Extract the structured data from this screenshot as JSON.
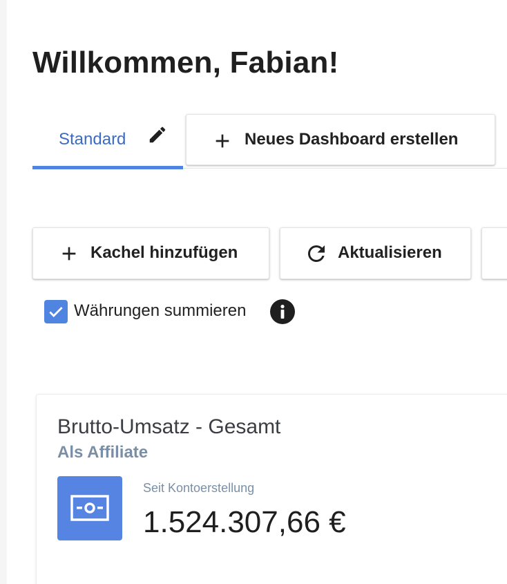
{
  "header": {
    "title": "Willkommen, Fabian!"
  },
  "tabs": {
    "active_tab_label": "Standard",
    "new_dashboard_label": "Neues Dashboard erstellen"
  },
  "toolbar": {
    "add_tile_label": "Kachel hinzufügen",
    "refresh_label": "Aktualisieren"
  },
  "options": {
    "sum_currencies_label": "Währungen summieren",
    "sum_currencies_checked": true
  },
  "card": {
    "title": "Brutto-Umsatz - Gesamt",
    "subtitle": "Als Affiliate",
    "period": "Seit Kontoerstellung",
    "value": "1.524.307,66 €",
    "icon": "money-icon"
  },
  "colors": {
    "accent": "#4f84e0",
    "tab_text": "#3b6bc4",
    "subtitle": "#7a8fa6"
  }
}
